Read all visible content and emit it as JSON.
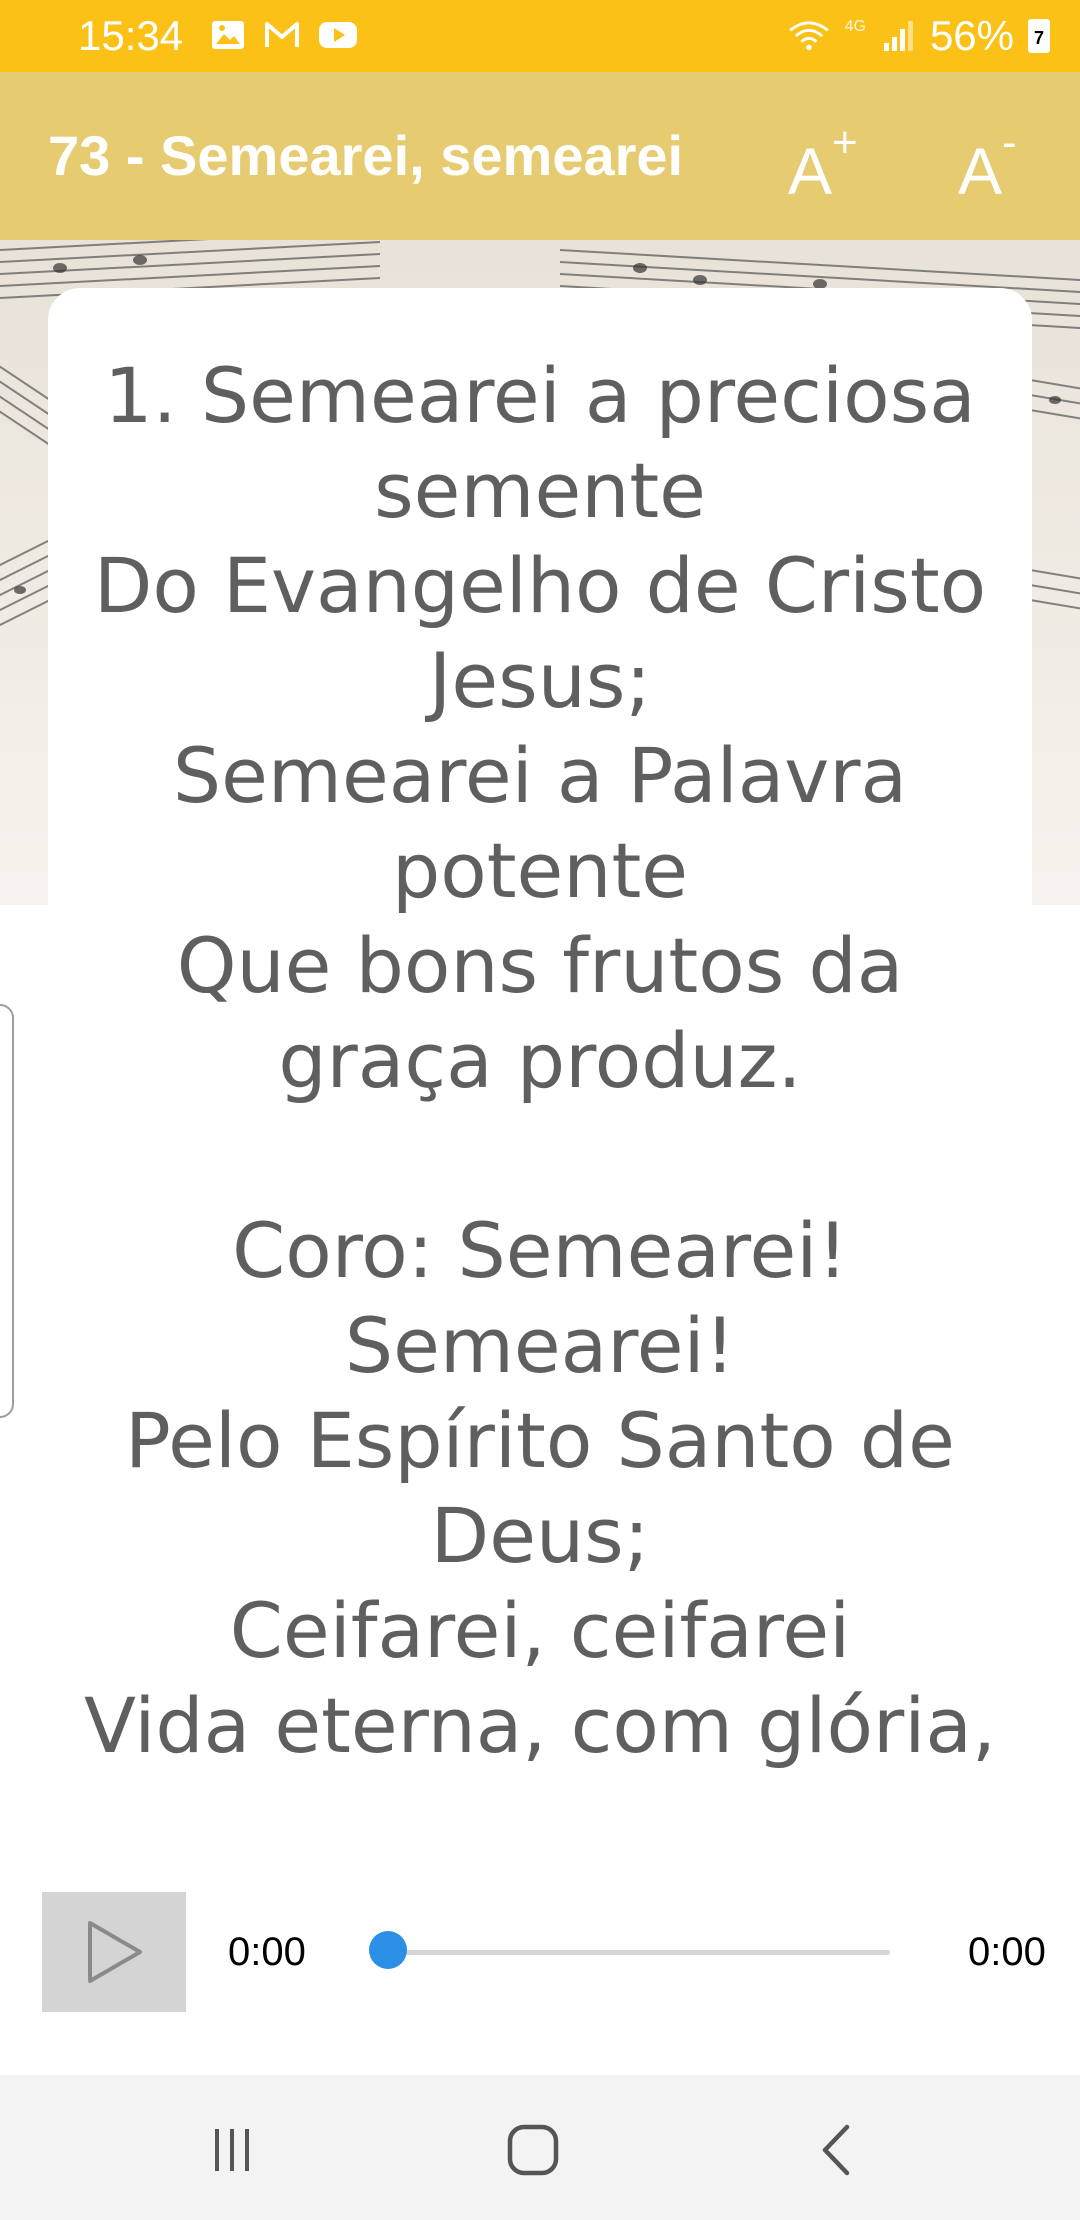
{
  "status_bar": {
    "time": "15:34",
    "battery_percent": "56%",
    "battery_level_label": "7",
    "network_label": "4G",
    "left_icons": [
      "gallery-icon",
      "gmail-icon",
      "youtube-icon"
    ],
    "right_icons": [
      "wifi-icon",
      "signal-icon",
      "battery-icon"
    ],
    "color": "#fcc117"
  },
  "app_bar": {
    "title": "73 - Semearei, semearei",
    "increase_font_label": "A",
    "increase_font_sup": "+",
    "decrease_font_label": "A",
    "decrease_font_sup": "-",
    "color": "#e6cb71"
  },
  "lyrics": {
    "lines": [
      "1. Semearei a preciosa",
      "semente",
      "Do Evangelho de Cristo",
      "Jesus;",
      "Semearei a Palavra",
      "potente",
      "Que bons frutos da",
      "graça produz.",
      "",
      "Coro: Semearei!",
      "Semearei!",
      "Pelo Espírito Santo de",
      "Deus;",
      "Ceifarei, ceifarei",
      "Vida eterna, com glória,"
    ]
  },
  "player": {
    "current_time": "0:00",
    "duration": "0:00",
    "progress": 0,
    "accent_color": "#2c8fe6",
    "play_icon": "play-icon"
  },
  "nav_bar": {
    "buttons": [
      "recent-apps-icon",
      "home-icon",
      "back-icon"
    ]
  }
}
